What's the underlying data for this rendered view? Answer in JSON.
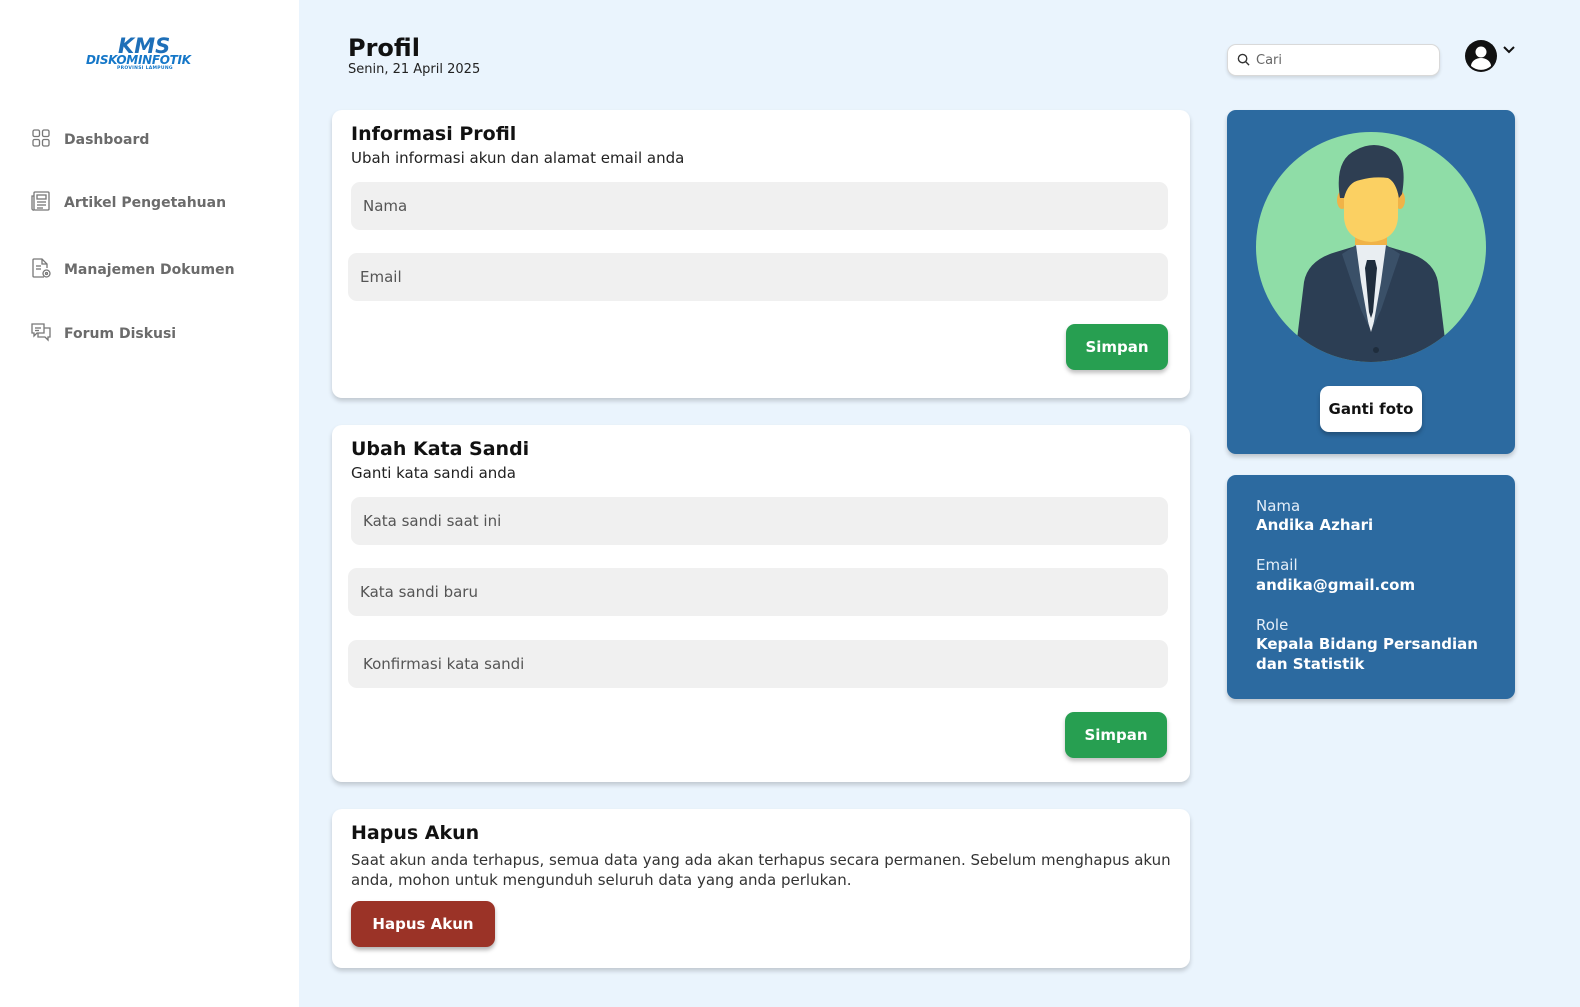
{
  "brand": {
    "logo_top": "KMS",
    "logo_main": "DISKOMINFOTIK",
    "logo_sub": "PROVINSI LAMPUNG"
  },
  "sidebar": {
    "items": [
      {
        "label": "Dashboard",
        "icon": "dashboard-grid-icon"
      },
      {
        "label": "Artikel Pengetahuan",
        "icon": "newspaper-icon"
      },
      {
        "label": "Manajemen Dokumen",
        "icon": "document-settings-icon"
      },
      {
        "label": "Forum Diskusi",
        "icon": "chat-bubbles-icon"
      }
    ]
  },
  "header": {
    "title": "Profil",
    "date": "Senin, 21 April 2025",
    "search_placeholder": "Cari"
  },
  "profile_info": {
    "title": "Informasi Profil",
    "subtitle": "Ubah informasi akun dan alamat email anda",
    "name_placeholder": "Nama",
    "email_placeholder": "Email",
    "save_label": "Simpan"
  },
  "change_password": {
    "title": "Ubah Kata Sandi",
    "subtitle": "Ganti kata sandi anda",
    "current_placeholder": "Kata sandi saat ini",
    "new_placeholder": "Kata sandi baru",
    "confirm_placeholder": "Konfirmasi kata sandi",
    "save_label": "Simpan"
  },
  "delete_account": {
    "title": "Hapus Akun",
    "description": "Saat akun anda terhapus, semua data yang ada akan terhapus secara permanen. Sebelum menghapus akun anda, mohon untuk mengunduh seluruh data yang anda perlukan.",
    "button_label": "Hapus Akun"
  },
  "photo_panel": {
    "change_photo_label": "Ganti foto"
  },
  "user_info": {
    "name_label": "Nama",
    "name_value": "Andika Azhari",
    "email_label": "Email",
    "email_value": "andika@gmail.com",
    "role_label": "Role",
    "role_value": "Kepala Bidang Persandian dan Statistik"
  },
  "colors": {
    "background": "#eaf4fd",
    "primary_blue": "#2c6aa0",
    "save_green": "#279f51",
    "danger_red": "#9b3327"
  }
}
